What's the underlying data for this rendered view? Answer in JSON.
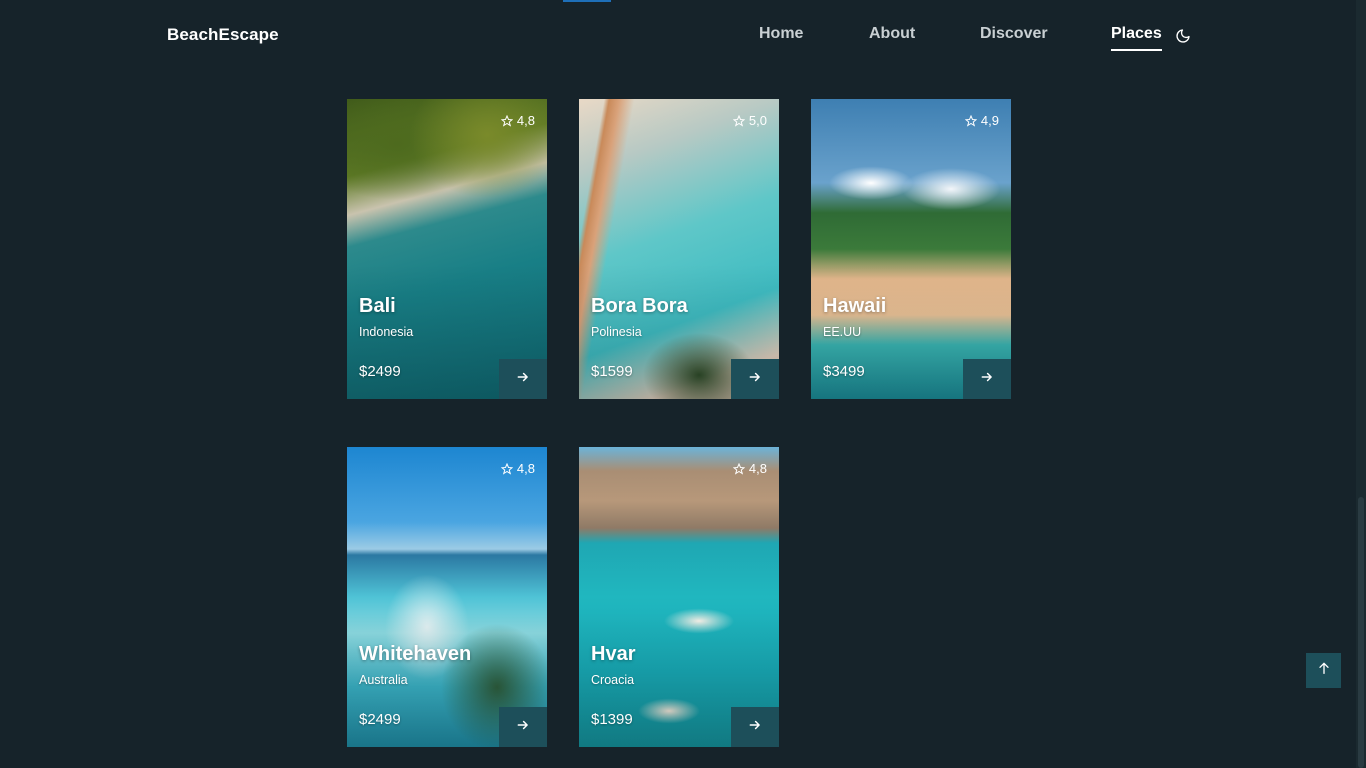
{
  "header": {
    "brand": "BeachEscape",
    "nav": [
      {
        "label": "Home"
      },
      {
        "label": "About"
      },
      {
        "label": "Discover"
      },
      {
        "label": "Places"
      }
    ],
    "active_nav": "Places",
    "theme_toggle_icon": "moon-icon"
  },
  "places": [
    {
      "name": "Bali",
      "country": "Indonesia",
      "price": "$2499",
      "rating": "4,8"
    },
    {
      "name": "Bora Bora",
      "country": "Polinesia",
      "price": "$1599",
      "rating": "5,0"
    },
    {
      "name": "Hawaii",
      "country": "EE.UU",
      "price": "$3499",
      "rating": "4,9"
    },
    {
      "name": "Whitehaven",
      "country": "Australia",
      "price": "$2499",
      "rating": "4,8"
    },
    {
      "name": "Hvar",
      "country": "Croacia",
      "price": "$1399",
      "rating": "4,8"
    }
  ],
  "icons": {
    "rating": "star-icon",
    "card_button": "arrow-right-icon",
    "scroll_top": "arrow-up-icon"
  },
  "colors": {
    "background": "#16232a",
    "accent": "#1d4f5a",
    "text": "#ffffff"
  }
}
